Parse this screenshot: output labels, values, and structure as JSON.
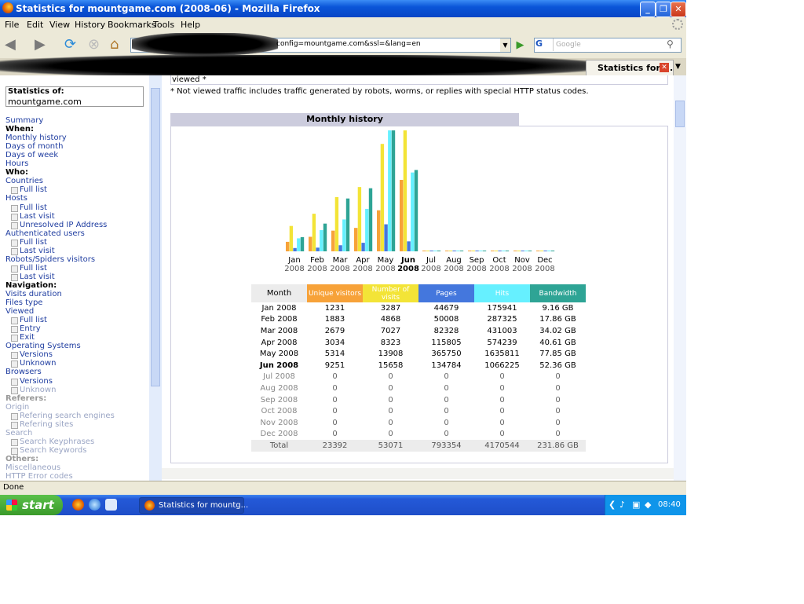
{
  "window": {
    "title": "Statistics for mountgame.com (2008-06) - Mozilla Firefox"
  },
  "menu": [
    "File",
    "Edit",
    "View",
    "History",
    "Bookmarks",
    "Tools",
    "Help"
  ],
  "toolbar": {
    "url": "config=mountgame.com&ssl=&lang=en",
    "search_placeholder": "Google",
    "search_engine": "G"
  },
  "tab": {
    "label": "Statistics for ..."
  },
  "sidebar": {
    "stats_of_label": "Statistics of:",
    "host": "mountgame.com",
    "items": [
      {
        "label": "Summary",
        "kind": "link"
      },
      {
        "label": "When:",
        "kind": "head"
      },
      {
        "label": "Monthly history",
        "kind": "link"
      },
      {
        "label": "Days of month",
        "kind": "link"
      },
      {
        "label": "Days of week",
        "kind": "link"
      },
      {
        "label": "Hours",
        "kind": "link"
      },
      {
        "label": "Who:",
        "kind": "head"
      },
      {
        "label": "Countries",
        "kind": "link"
      },
      {
        "label": "Full list",
        "kind": "sub"
      },
      {
        "label": "Hosts",
        "kind": "link"
      },
      {
        "label": "Full list",
        "kind": "sub"
      },
      {
        "label": "Last visit",
        "kind": "sub"
      },
      {
        "label": "Unresolved IP Address",
        "kind": "sub"
      },
      {
        "label": "Authenticated users",
        "kind": "link"
      },
      {
        "label": "Full list",
        "kind": "sub"
      },
      {
        "label": "Last visit",
        "kind": "sub"
      },
      {
        "label": "Robots/Spiders visitors",
        "kind": "link"
      },
      {
        "label": "Full list",
        "kind": "sub"
      },
      {
        "label": "Last visit",
        "kind": "sub"
      },
      {
        "label": "Navigation:",
        "kind": "head"
      },
      {
        "label": "Visits duration",
        "kind": "link"
      },
      {
        "label": "Files type",
        "kind": "link"
      },
      {
        "label": "Viewed",
        "kind": "link"
      },
      {
        "label": "Full list",
        "kind": "sub"
      },
      {
        "label": "Entry",
        "kind": "sub"
      },
      {
        "label": "Exit",
        "kind": "sub"
      },
      {
        "label": "Operating Systems",
        "kind": "link"
      },
      {
        "label": "Versions",
        "kind": "sub"
      },
      {
        "label": "Unknown",
        "kind": "sub"
      },
      {
        "label": "Browsers",
        "kind": "link"
      },
      {
        "label": "Versions",
        "kind": "sub"
      },
      {
        "label": "Unknown",
        "kind": "subdim"
      },
      {
        "label": "Referers:",
        "kind": "headdim"
      },
      {
        "label": "Origin",
        "kind": "dim"
      },
      {
        "label": "Refering search engines",
        "kind": "subdim"
      },
      {
        "label": "Refering sites",
        "kind": "subdim"
      },
      {
        "label": "Search",
        "kind": "dim"
      },
      {
        "label": "Search Keyphrases",
        "kind": "subdim"
      },
      {
        "label": "Search Keywords",
        "kind": "subdim"
      },
      {
        "label": "Others:",
        "kind": "headdim"
      },
      {
        "label": "Miscellaneous",
        "kind": "dim"
      },
      {
        "label": "HTTP Error codes",
        "kind": "dim"
      }
    ]
  },
  "main": {
    "viewed_row_label": "viewed *",
    "footnote": "* Not viewed traffic includes traffic generated by robots, worms, or replies with special HTTP status codes.",
    "section_title": "Monthly history"
  },
  "colors": {
    "unique_visitors": "#f7a239",
    "visits": "#f3e437",
    "pages": "#4477dd",
    "hits": "#66f0ff",
    "bandwidth": "#2ea495"
  },
  "chart_data": {
    "type": "bar",
    "categories": [
      "Jan 2008",
      "Feb 2008",
      "Mar 2008",
      "Apr 2008",
      "May 2008",
      "Jun 2008",
      "Jul 2008",
      "Aug 2008",
      "Sep 2008",
      "Oct 2008",
      "Nov 2008",
      "Dec 2008"
    ],
    "month_labels": [
      "Jan",
      "Feb",
      "Mar",
      "Apr",
      "May",
      "Jun",
      "Jul",
      "Aug",
      "Sep",
      "Oct",
      "Nov",
      "Dec"
    ],
    "year_label": "2008",
    "current_index": 5,
    "series": [
      {
        "name": "Unique visitors",
        "values": [
          1231,
          1883,
          2679,
          3034,
          5314,
          9251,
          0,
          0,
          0,
          0,
          0,
          0
        ]
      },
      {
        "name": "Number of visits",
        "values": [
          3287,
          4868,
          7027,
          8323,
          13908,
          15658,
          0,
          0,
          0,
          0,
          0,
          0
        ]
      },
      {
        "name": "Pages",
        "values": [
          44679,
          50008,
          82328,
          115805,
          365750,
          134784,
          0,
          0,
          0,
          0,
          0,
          0
        ]
      },
      {
        "name": "Hits",
        "values": [
          175941,
          287325,
          431003,
          574239,
          1635811,
          1066225,
          0,
          0,
          0,
          0,
          0,
          0
        ]
      },
      {
        "name": "Bandwidth",
        "values": [
          9.16,
          17.86,
          34.02,
          40.61,
          77.85,
          52.36,
          0,
          0,
          0,
          0,
          0,
          0
        ]
      }
    ]
  },
  "table": {
    "headers": [
      "Month",
      "Unique visitors",
      "Number of visits",
      "Pages",
      "Hits",
      "Bandwidth"
    ],
    "rows": [
      [
        "Jan 2008",
        "1231",
        "3287",
        "44679",
        "175941",
        "9.16 GB"
      ],
      [
        "Feb 2008",
        "1883",
        "4868",
        "50008",
        "287325",
        "17.86 GB"
      ],
      [
        "Mar 2008",
        "2679",
        "7027",
        "82328",
        "431003",
        "34.02 GB"
      ],
      [
        "Apr 2008",
        "3034",
        "8323",
        "115805",
        "574239",
        "40.61 GB"
      ],
      [
        "May 2008",
        "5314",
        "13908",
        "365750",
        "1635811",
        "77.85 GB"
      ],
      [
        "Jun 2008",
        "9251",
        "15658",
        "134784",
        "1066225",
        "52.36 GB"
      ],
      [
        "Jul 2008",
        "0",
        "0",
        "0",
        "0",
        "0"
      ],
      [
        "Aug 2008",
        "0",
        "0",
        "0",
        "0",
        "0"
      ],
      [
        "Sep 2008",
        "0",
        "0",
        "0",
        "0",
        "0"
      ],
      [
        "Oct 2008",
        "0",
        "0",
        "0",
        "0",
        "0"
      ],
      [
        "Nov 2008",
        "0",
        "0",
        "0",
        "0",
        "0"
      ],
      [
        "Dec 2008",
        "0",
        "0",
        "0",
        "0",
        "0"
      ]
    ],
    "total": [
      "Total",
      "23392",
      "53071",
      "793354",
      "4170544",
      "231.86 GB"
    ]
  },
  "status": {
    "text": "Done"
  },
  "taskbar": {
    "start_label": "start",
    "task_label": "Statistics for mountg...",
    "clock": "08:40"
  }
}
